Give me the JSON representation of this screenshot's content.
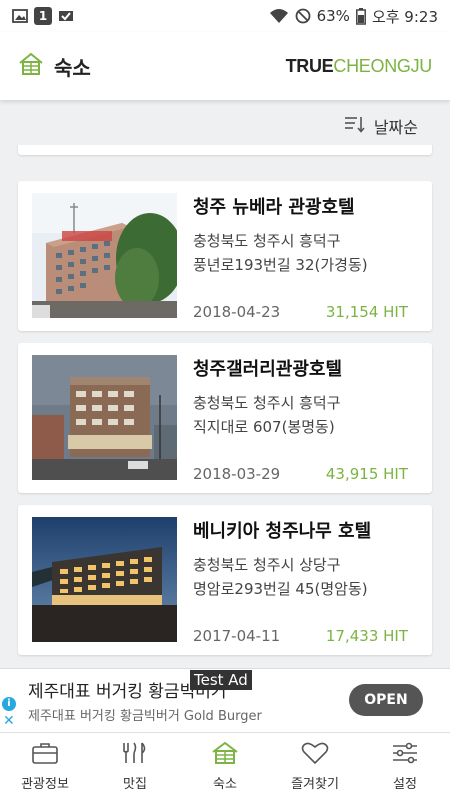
{
  "status_bar": {
    "left_badge": "1",
    "battery": "63%",
    "time": "오후 9:23"
  },
  "app_bar": {
    "title": "숙소",
    "logo_true": "TRUE",
    "logo_cheongju": "CHEONGJU"
  },
  "sort": {
    "label": "날짜순"
  },
  "listings": [
    {
      "name": "청주 뉴베라 관광호텔",
      "address_line1": "충청북도 청주시 흥덕구",
      "address_line2": "풍년로193번길 32(가경동)",
      "date": "2018-04-23",
      "hits": "31,154 HIT"
    },
    {
      "name": "청주갤러리관광호텔",
      "address_line1": "충청북도 청주시 흥덕구",
      "address_line2": "직지대로 607(봉명동)",
      "date": "2018-03-29",
      "hits": "43,915 HIT"
    },
    {
      "name": "베니키아 청주나무 호텔",
      "address_line1": "충청북도 청주시 상당구",
      "address_line2": "명암로293번길 45(명암동)",
      "date": "2017-04-11",
      "hits": "17,433 HIT"
    }
  ],
  "ad": {
    "headline": "제주대표 버거킹 황금빅버거",
    "sub": "제주대표 버거킹 황금빅버거 Gold Burger",
    "test_label": "Test Ad",
    "open_label": "OPEN"
  },
  "bottom_nav": [
    {
      "label": "관광정보",
      "icon": "briefcase-icon"
    },
    {
      "label": "맛집",
      "icon": "utensils-icon"
    },
    {
      "label": "숙소",
      "icon": "house-icon",
      "active": true
    },
    {
      "label": "즐겨찾기",
      "icon": "heart-icon"
    },
    {
      "label": "설정",
      "icon": "sliders-icon"
    }
  ],
  "colors": {
    "accent": "#7cb342",
    "ad_blue": "#29a7df"
  }
}
